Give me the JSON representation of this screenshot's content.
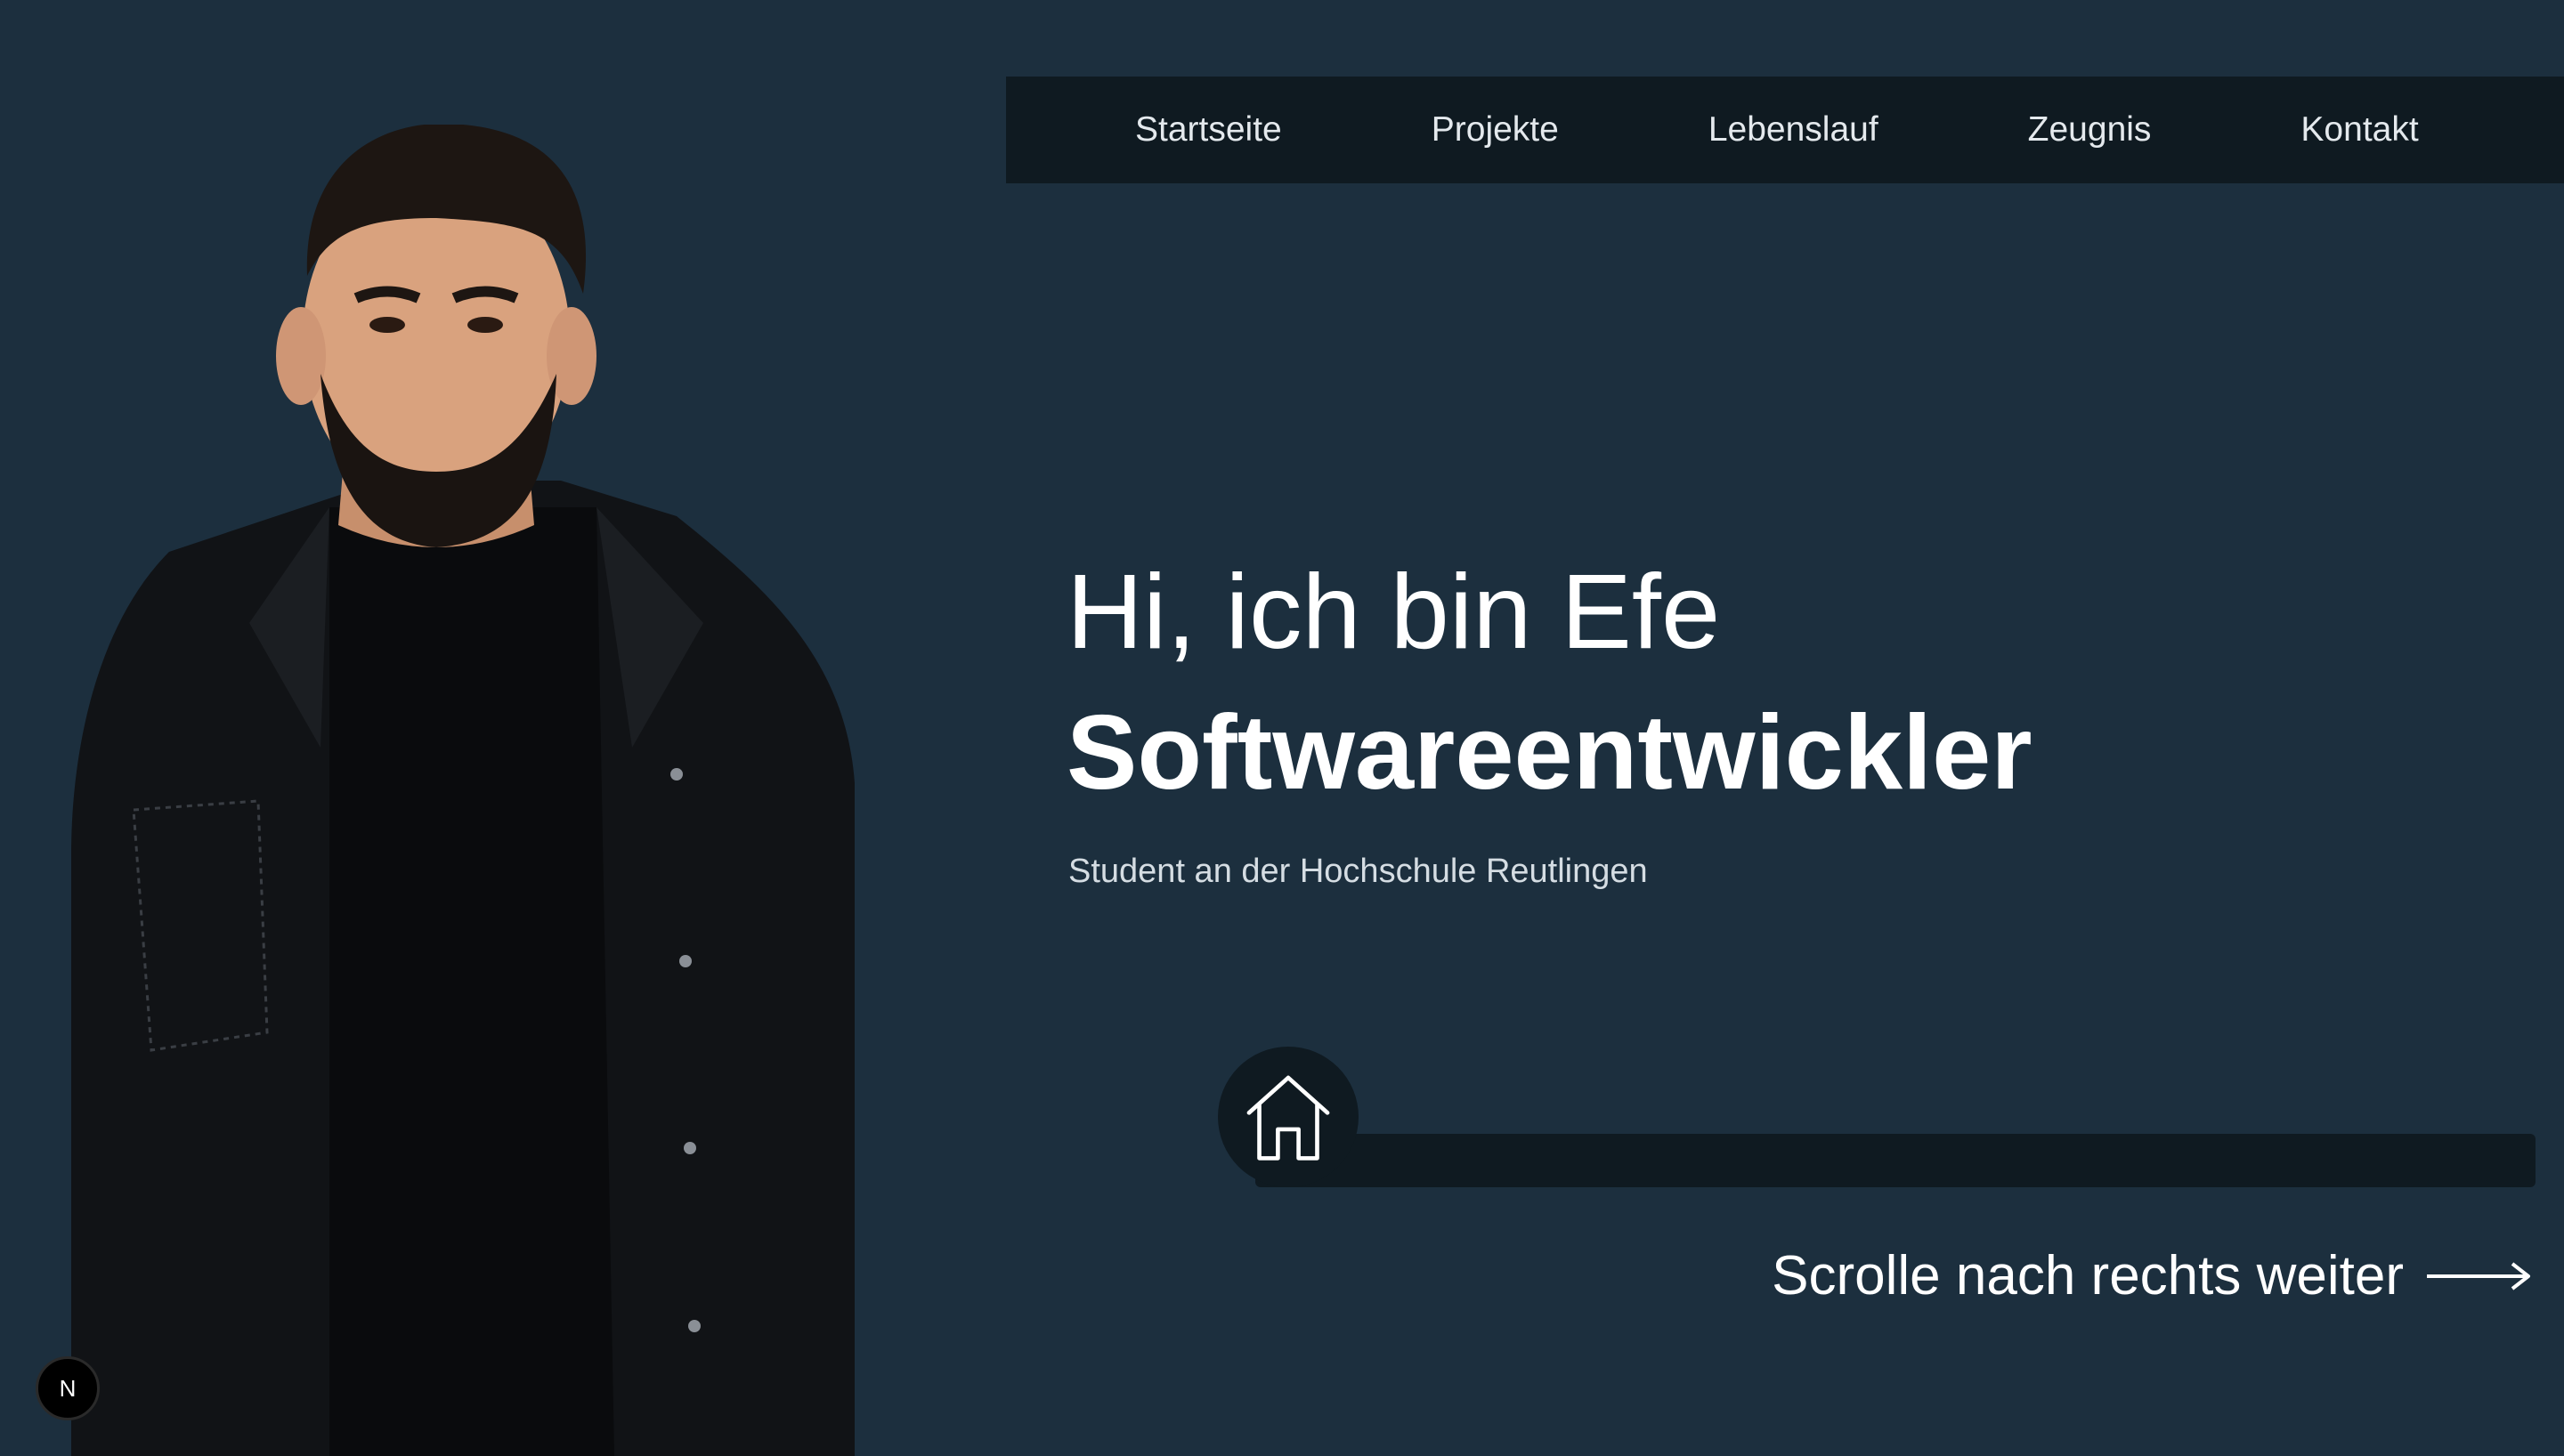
{
  "nav": {
    "items": [
      {
        "label": "Startseite"
      },
      {
        "label": "Projekte"
      },
      {
        "label": "Lebenslauf"
      },
      {
        "label": "Zeugnis"
      },
      {
        "label": "Kontakt"
      }
    ]
  },
  "hero": {
    "greeting": "Hi, ich bin Efe",
    "role": "Softwareentwickler",
    "subtitle": "Student an der Hochschule Reutlingen"
  },
  "progress": {
    "icon": "home-icon",
    "value": 0
  },
  "scroll_hint": {
    "label": "Scrolle nach rechts weiter",
    "icon": "arrow-right-icon"
  },
  "dev_badge": {
    "label": "N"
  },
  "colors": {
    "background": "#1c2f3e",
    "nav_background": "#0f1a21",
    "text": "#ffffff"
  }
}
